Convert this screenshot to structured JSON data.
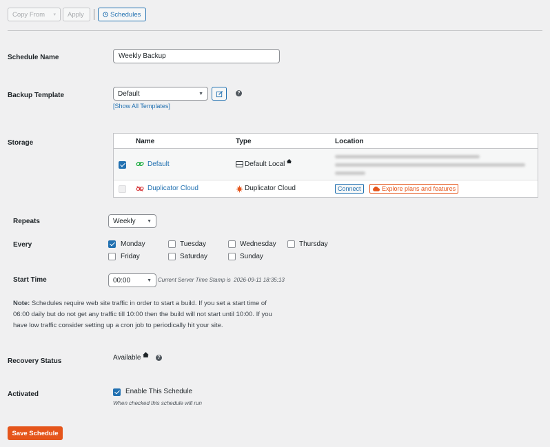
{
  "toolbar": {
    "copy_from": "Copy From",
    "apply": "Apply",
    "schedules": "Schedules"
  },
  "schedule_name": {
    "label": "Schedule Name",
    "value": "Weekly Backup"
  },
  "backup_template": {
    "label": "Backup Template",
    "value": "Default",
    "show_all": "[Show All Templates]"
  },
  "storage": {
    "label": "Storage",
    "headers": {
      "name": "Name",
      "type": "Type",
      "location": "Location"
    },
    "rows": [
      {
        "name": "Default",
        "type": "Default Local",
        "checked": true
      },
      {
        "name": "Duplicator Cloud",
        "type": "Duplicator Cloud",
        "checked": false,
        "connect": "Connect",
        "explore": "Explore plans and features"
      }
    ]
  },
  "repeats": {
    "label": "Repeats",
    "value": "Weekly"
  },
  "every": {
    "label": "Every",
    "days": [
      {
        "name": "Monday",
        "checked": true
      },
      {
        "name": "Tuesday",
        "checked": false
      },
      {
        "name": "Wednesday",
        "checked": false
      },
      {
        "name": "Thursday",
        "checked": false
      },
      {
        "name": "Friday",
        "checked": false
      },
      {
        "name": "Saturday",
        "checked": false
      },
      {
        "name": "Sunday",
        "checked": false
      }
    ]
  },
  "start_time": {
    "label": "Start Time",
    "value": "00:00",
    "server_stamp": "Current Server Time Stamp is  2026-09-11 18:35:13"
  },
  "note": {
    "bold": "Note:",
    "line1": " Schedules require web site traffic in order to start a build. If you set a start time of",
    "line2": "06:00 daily but do not get any traffic till 10:00 then the build will not start until 10:00. If you",
    "line3": "have low traffic consider setting up a cron job to periodically hit your site."
  },
  "recovery": {
    "label": "Recovery Status",
    "value": "Available"
  },
  "activated": {
    "label": "Activated",
    "checkbox_label": "Enable This Schedule",
    "hint": "When checked this schedule will run"
  },
  "save_button": "Save Schedule",
  "colors": {
    "accent": "#2271b1",
    "save": "#e5551b",
    "cloud": "#e5551b",
    "green": "#00a32a"
  }
}
